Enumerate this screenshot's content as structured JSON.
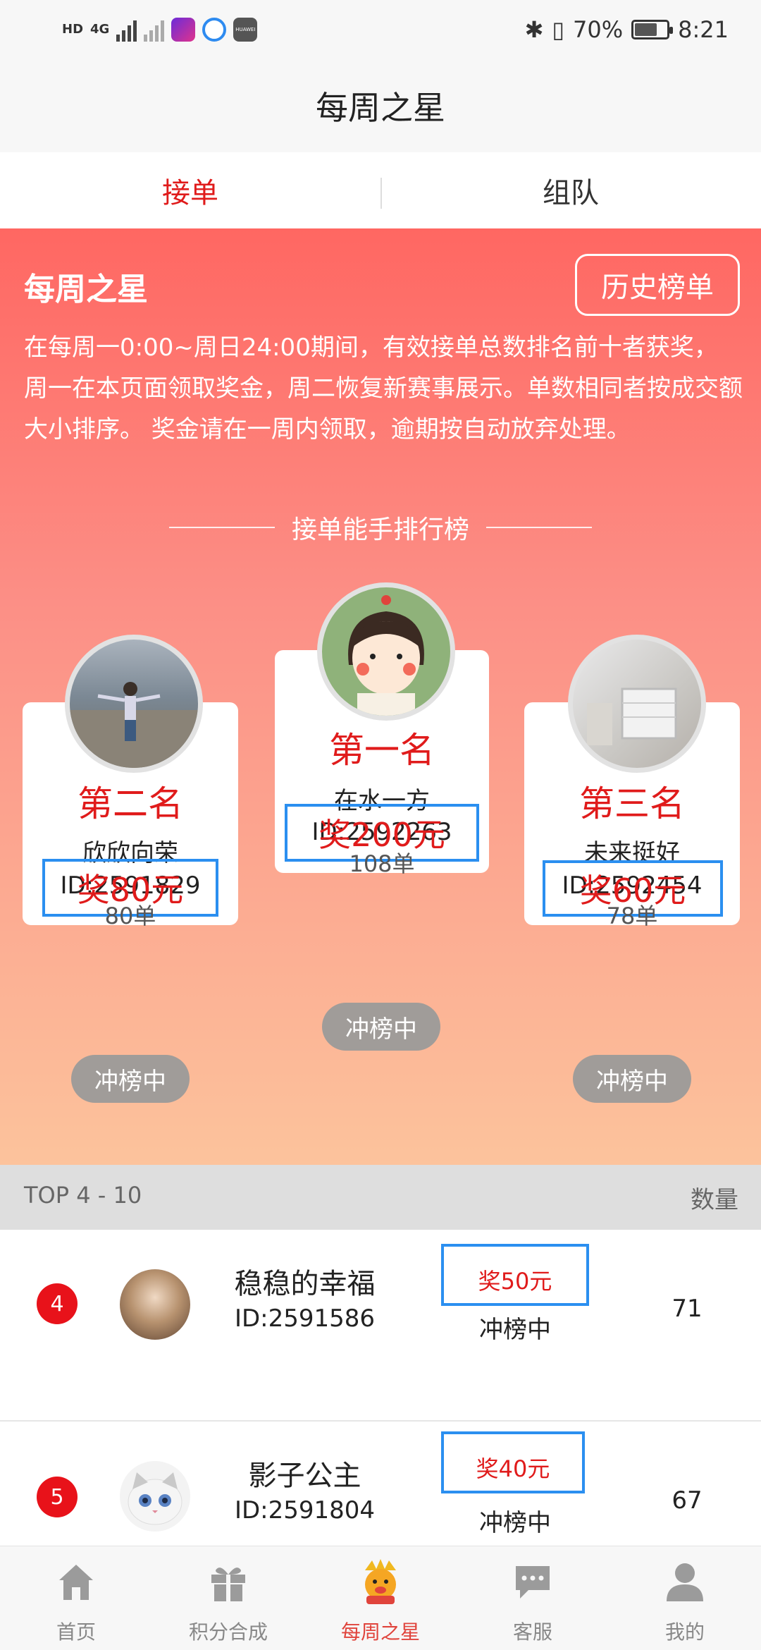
{
  "status_bar": {
    "hd_label": "HD",
    "net_label": "4G",
    "app_labels": [
      "HUAWEI"
    ],
    "battery": "70%",
    "battery_level": 0.7,
    "time": "8:21"
  },
  "header": {
    "title": "每周之星"
  },
  "tabs": [
    {
      "label": "接单",
      "active": true
    },
    {
      "label": "组队",
      "active": false
    }
  ],
  "hero": {
    "title": "每周之星",
    "history_button": "历史榜单",
    "description": "在每周一0:00~周日24:00期间，有效接单总数排名前十者获奖， 周一在本页面领取奖金，周二恢复新赛事展示。单数相同者按成交额大小排序。 奖金请在一周内领取，逾期按自动放弃处理。",
    "ranking_title": "接单能手排行榜",
    "ranking_title_deco": "————",
    "podium": {
      "first": {
        "rank": "第一名",
        "name": "在水一方",
        "id": "ID:2592263",
        "prize": "奖200元",
        "orders": "108单",
        "status": "冲榜中"
      },
      "second": {
        "rank": "第二名",
        "name": "欣欣向荣",
        "id": "ID:2591829",
        "prize": "奖80元",
        "orders": "80单",
        "status": "冲榜中"
      },
      "third": {
        "rank": "第三名",
        "name": "未来挺好",
        "id": "ID:2592454",
        "prize": "奖60元",
        "orders": "78单",
        "status": "冲榜中"
      }
    }
  },
  "top_list": {
    "header_left": "TOP 4 - 10",
    "header_right": "数量",
    "rows": [
      {
        "rank": "4",
        "name": "稳稳的幸福",
        "id": "ID:2591586",
        "prize": "奖50元",
        "status": "冲榜中",
        "count": "71"
      },
      {
        "rank": "5",
        "name": "影子公主",
        "id": "ID:2591804",
        "prize": "奖40元",
        "status": "冲榜中",
        "count": "67"
      }
    ]
  },
  "bottom_nav": {
    "items": [
      {
        "label": "首页",
        "icon": "home-icon"
      },
      {
        "label": "积分合成",
        "icon": "gift-icon"
      },
      {
        "label": "每周之星",
        "icon": "mascot-icon",
        "active": true
      },
      {
        "label": "客服",
        "icon": "chat-icon"
      },
      {
        "label": "我的",
        "icon": "user-icon"
      }
    ]
  },
  "colors": {
    "accent_red": "#e01b1b",
    "prize_border_blue": "#2b8ff0",
    "hero_top": "#ff6762",
    "hero_bottom": "#fcc39c",
    "nav_active": "#e0443c"
  }
}
